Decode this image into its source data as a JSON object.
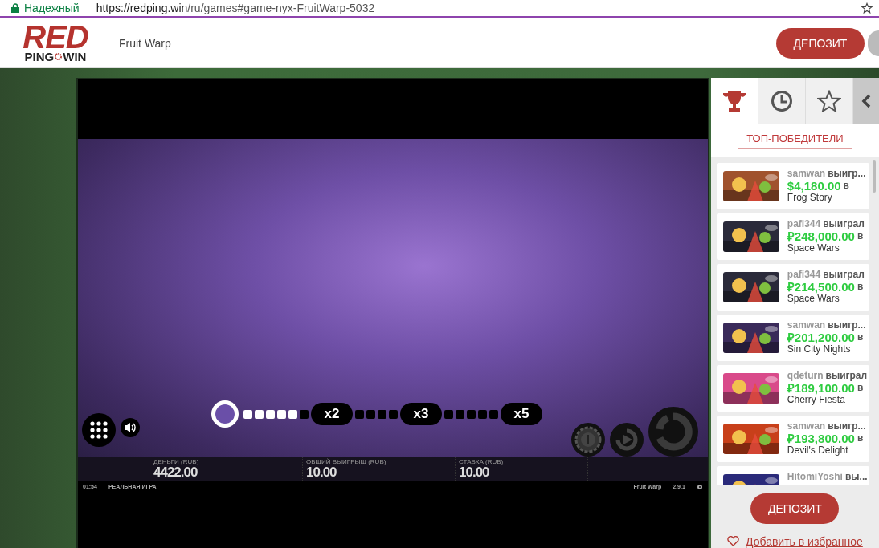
{
  "browser": {
    "security": "Надежный",
    "url_host": "https://redping.win",
    "url_path": "/ru/games#game-nyx-FruitWarp-5032"
  },
  "header": {
    "logo": {
      "top": "RED",
      "bottom_left": "PING",
      "bottom_right": "WIN"
    },
    "game_title": "Fruit Warp",
    "deposit": "ДЕПОЗИТ"
  },
  "game": {
    "track": [
      {
        "kind": "fruit"
      },
      {
        "kind": "square",
        "lit": true
      },
      {
        "kind": "square",
        "lit": true
      },
      {
        "kind": "square",
        "lit": true
      },
      {
        "kind": "square",
        "lit": true
      },
      {
        "kind": "square",
        "lit": true
      },
      {
        "kind": "square",
        "lit": false
      },
      {
        "kind": "multiplier",
        "label": "x2"
      },
      {
        "kind": "square",
        "lit": false
      },
      {
        "kind": "square",
        "lit": false
      },
      {
        "kind": "square",
        "lit": false
      },
      {
        "kind": "square",
        "lit": false
      },
      {
        "kind": "multiplier",
        "label": "x3"
      },
      {
        "kind": "square",
        "lit": false
      },
      {
        "kind": "square",
        "lit": false
      },
      {
        "kind": "square",
        "lit": false
      },
      {
        "kind": "square",
        "lit": false
      },
      {
        "kind": "square",
        "lit": false
      },
      {
        "kind": "multiplier",
        "label": "x5"
      }
    ],
    "stats": [
      {
        "label": "ДЕНЬГИ (RUB)",
        "value": "4422.00"
      },
      {
        "label": "ОБЩИЙ ВЫИГРЫШ (RUB)",
        "value": "10.00"
      },
      {
        "label": "СТАВКА (RUB)",
        "value": "10.00"
      }
    ],
    "footer": {
      "time": "01:54",
      "mode": "РЕАЛЬНАЯ ИГРА",
      "name": "Fruit Warp",
      "version": "2.9.1"
    }
  },
  "sidebar": {
    "tabs": [
      {
        "kind": "trophy",
        "selected": true
      },
      {
        "kind": "clock",
        "selected": false
      },
      {
        "kind": "star",
        "selected": false
      }
    ],
    "heading": "ТОП-ПОБЕДИТЕЛИ",
    "winners": [
      {
        "user": "samwan",
        "verb": "выигр...",
        "amount": "$4,180.00",
        "in": "в",
        "game": "Frog Story"
      },
      {
        "user": "pafi344",
        "verb": "выиграл",
        "amount": "₽248,000.00",
        "in": "в",
        "game": "Space Wars"
      },
      {
        "user": "pafi344",
        "verb": "выиграл",
        "amount": "₽214,500.00",
        "in": "в",
        "game": "Space Wars"
      },
      {
        "user": "samwan",
        "verb": "выигр...",
        "amount": "₽201,200.00",
        "in": "в",
        "game": "Sin City Nights"
      },
      {
        "user": "qdeturn",
        "verb": "выиграл",
        "amount": "₽189,100.00",
        "in": "в",
        "game": "Cherry Fiesta"
      },
      {
        "user": "samwan",
        "verb": "выигр...",
        "amount": "₽193,800.00",
        "in": "в",
        "game": "Devil's Delight"
      },
      {
        "user": "HitomiYoshi",
        "verb": "вы..."
      }
    ],
    "deposit": "ДЕПОЗИТ",
    "favorite": "Добавить в избранное"
  }
}
